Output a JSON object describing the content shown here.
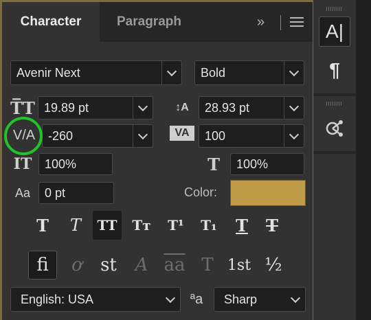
{
  "tabs": {
    "character": "Character",
    "paragraph": "Paragraph",
    "expand_glyph": "»"
  },
  "font": {
    "family": "Avenir Next",
    "style": "Bold"
  },
  "size": {
    "font_size": "19.89 pt",
    "leading": "28.93 pt"
  },
  "spacing": {
    "kerning": "-260",
    "tracking": "100"
  },
  "scale": {
    "vertical": "100%",
    "horizontal": "100%"
  },
  "baseline": {
    "shift": "0 pt"
  },
  "color": {
    "label": "Color:",
    "value": "#bf9b48"
  },
  "icons": {
    "font_size": "T̅T",
    "leading": "↕A",
    "kerning": "V/A",
    "tracking": "VA",
    "vscale": "IT",
    "hscale": "T",
    "baseline": "Aa"
  },
  "type_styles": [
    {
      "glyph": "T",
      "name": "faux-bold"
    },
    {
      "glyph": "T",
      "name": "faux-italic"
    },
    {
      "glyph": "TT",
      "name": "all-caps"
    },
    {
      "glyph": "Tт",
      "name": "small-caps"
    },
    {
      "glyph": "T¹",
      "name": "superscript"
    },
    {
      "glyph": "T₁",
      "name": "subscript"
    },
    {
      "glyph": "T",
      "name": "underline"
    },
    {
      "glyph": "T",
      "name": "strikethrough"
    }
  ],
  "opentype": [
    {
      "glyph": "fi",
      "name": "standard-ligatures"
    },
    {
      "glyph": "ơ",
      "name": "contextual-alternates"
    },
    {
      "glyph": "st",
      "name": "discretionary-ligatures"
    },
    {
      "glyph": "A",
      "name": "swash"
    },
    {
      "glyph": "aa",
      "name": "stylistic-alternates"
    },
    {
      "glyph": "T",
      "name": "titling-alternates"
    },
    {
      "glyph": "1st",
      "name": "ordinals"
    },
    {
      "glyph": "½",
      "name": "fractions"
    }
  ],
  "language": "English: USA",
  "antialias": {
    "icon": "ªa",
    "value": "Sharp"
  },
  "side_panel": {
    "character_btn": "A|",
    "paragraph_btn": "¶"
  }
}
